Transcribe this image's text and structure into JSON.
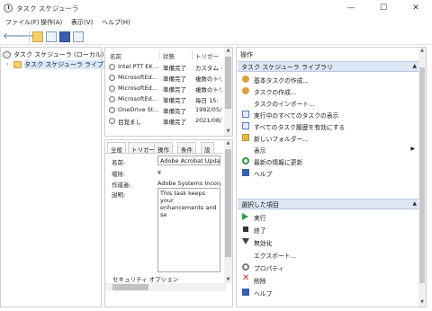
{
  "window": {
    "title": "タスク スケジューラ",
    "minimize": "—",
    "maximize": "☐",
    "close": "✕"
  },
  "menu": [
    "ファイル(F)",
    "操作(A)",
    "表示(V)",
    "ヘルプ(H)"
  ],
  "toolbar": {
    "icons": [
      "back-arrow-icon",
      "forward-arrow-icon",
      "folder-up-icon",
      "show-hide-tree-icon",
      "help-icon",
      "pane-icon"
    ],
    "back": "🡐",
    "forward": "🡒"
  },
  "tree": {
    "root": "タスク スケジューラ (ローカル)",
    "child": "タスク スケジューラ ライブラリ",
    "child_toggle": "›"
  },
  "task_list": {
    "columns": [
      "名前",
      "状態",
      "トリガー"
    ],
    "rows": [
      {
        "name": "Intel PTT EK ...",
        "status": "準備完了",
        "trigger": "カスタム イ"
      },
      {
        "name": "MicrosoftEd...",
        "status": "準備完了",
        "trigger": "複数のトリ"
      },
      {
        "name": "MicrosoftEd...",
        "status": "準備完了",
        "trigger": "複数のトリ"
      },
      {
        "name": "MicrosoftEd...",
        "status": "準備完了",
        "trigger": "毎日 15:"
      },
      {
        "name": "OneDrive St...",
        "status": "準備完了",
        "trigger": "1992/05/"
      },
      {
        "name": "目覚まし",
        "status": "準備完了",
        "trigger": "2021/08/"
      }
    ]
  },
  "details": {
    "tabs": [
      "全般",
      "トリガー",
      "操作",
      "条件",
      "設"
    ],
    "name_label": "名前:",
    "name_value": "Adobe Acrobat Updat",
    "location_label": "場所:",
    "location_value": "¥",
    "author_label": "作成者:",
    "author_value": "Adobe Systems Incorp",
    "description_label": "説明:",
    "description_value": "This task keeps your enhancements and se",
    "security_label": "セキュリティ オプション"
  },
  "actions_pane": {
    "title": "操作",
    "section1": "タスク スケジューラ ライブラリ",
    "section1_items": [
      {
        "label": "基本タスクの作成...",
        "icon": "create-basic-task-icon",
        "color": "#d9a441"
      },
      {
        "label": "タスクの作成...",
        "icon": "create-task-icon",
        "color": "#d9a441"
      },
      {
        "label": "タスクのインポート...",
        "icon": "",
        "color": ""
      },
      {
        "label": "実行中のすべてのタスクの表示",
        "icon": "running-tasks-icon",
        "color": "#5b7fb9"
      },
      {
        "label": "すべてのタスク履歴を有効にする",
        "icon": "task-history-icon",
        "color": "#5b7fb9"
      },
      {
        "label": "新しいフォルダー...",
        "icon": "new-folder-icon",
        "color": "#e3b94a"
      },
      {
        "label": "表示",
        "icon": "",
        "color": "",
        "submenu": "▶"
      },
      {
        "label": "最新の情報に更新",
        "icon": "refresh-icon",
        "color": "#2e9e3e"
      },
      {
        "label": "ヘルプ",
        "icon": "help-icon",
        "color": "#3a5fb0"
      }
    ],
    "section2": "選択した項目",
    "section2_items": [
      {
        "label": "実行",
        "icon": "run-icon",
        "color": "#2e9e3e"
      },
      {
        "label": "終了",
        "icon": "end-icon",
        "color": "#333333"
      },
      {
        "label": "無効化",
        "icon": "disable-icon",
        "color": "#444444"
      },
      {
        "label": "エクスポート...",
        "icon": "",
        "color": ""
      },
      {
        "label": "プロパティ",
        "icon": "properties-icon",
        "color": "#7a7a7a"
      },
      {
        "label": "削除",
        "icon": "delete-icon",
        "color": "#d62d20"
      },
      {
        "label": "ヘルプ",
        "icon": "help-icon",
        "color": "#3a5fb0"
      }
    ],
    "collapse_caret": "▲"
  }
}
